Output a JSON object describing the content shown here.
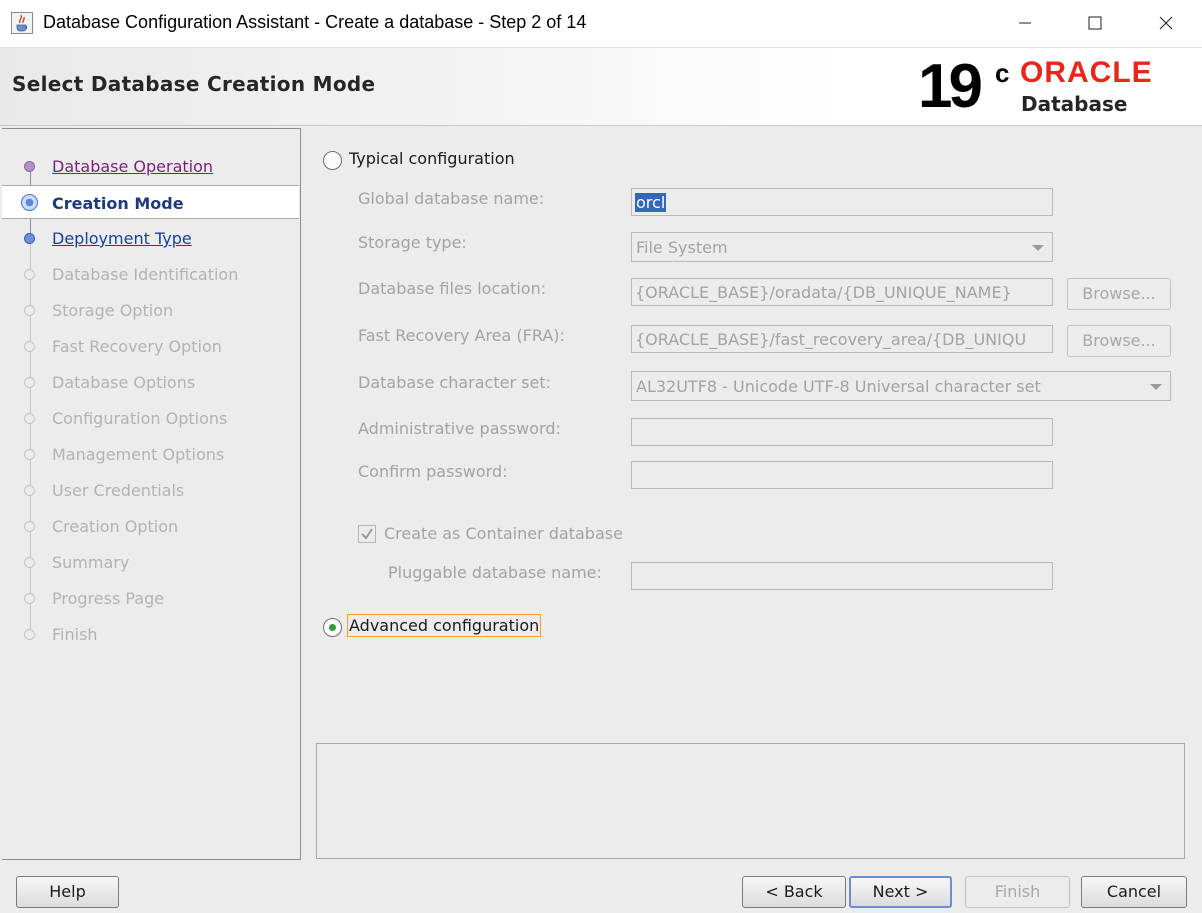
{
  "window": {
    "title": "Database Configuration Assistant - Create a database - Step 2 of 14",
    "icons": [
      "java-cup-icon",
      "minimize-icon",
      "maximize-icon",
      "close-icon"
    ]
  },
  "header": {
    "page_title": "Select Database Creation Mode",
    "logo_version": "19",
    "logo_version_sup": "c",
    "logo_brand": "ORACLE",
    "logo_product": "Database"
  },
  "steps": [
    {
      "label": "Database Operation",
      "state": "visited"
    },
    {
      "label": "Creation Mode",
      "state": "current"
    },
    {
      "label": "Deployment Type",
      "state": "link"
    },
    {
      "label": "Database Identification",
      "state": "disabled"
    },
    {
      "label": "Storage Option",
      "state": "disabled"
    },
    {
      "label": "Fast Recovery Option",
      "state": "disabled"
    },
    {
      "label": "Database Options",
      "state": "disabled"
    },
    {
      "label": "Configuration Options",
      "state": "disabled"
    },
    {
      "label": "Management Options",
      "state": "disabled"
    },
    {
      "label": "User Credentials",
      "state": "disabled"
    },
    {
      "label": "Creation Option",
      "state": "disabled"
    },
    {
      "label": "Summary",
      "state": "disabled"
    },
    {
      "label": "Progress Page",
      "state": "disabled"
    },
    {
      "label": "Finish",
      "state": "disabled"
    }
  ],
  "typical": {
    "radio_label": "Typical configuration",
    "selected": false,
    "global_db_name_label": "Global database name:",
    "global_db_name_value": "orcl",
    "storage_type_label": "Storage type:",
    "storage_type_value": "File System",
    "db_files_location_label": "Database files location:",
    "db_files_location_value": "{ORACLE_BASE}/oradata/{DB_UNIQUE_NAME}",
    "fra_label": "Fast Recovery Area (FRA):",
    "fra_value": "{ORACLE_BASE}/fast_recovery_area/{DB_UNIQU",
    "browse_label": "Browse...",
    "charset_label": "Database character set:",
    "charset_value": "AL32UTF8 - Unicode UTF-8 Universal character set",
    "admin_password_label": "Administrative password:",
    "admin_password_value": "",
    "confirm_password_label": "Confirm password:",
    "confirm_password_value": "",
    "container_checkbox_label": "Create as Container database",
    "container_checked": true,
    "pdb_name_label": "Pluggable database name:",
    "pdb_name_value": ""
  },
  "advanced": {
    "radio_label": "Advanced configuration",
    "selected": true
  },
  "buttons": {
    "help": "Help",
    "back": "< Back",
    "next": "Next >",
    "finish": "Finish",
    "cancel": "Cancel"
  },
  "colors": {
    "oracle_red": "#e8261c",
    "visited_step": "#7a1f7a",
    "link_step": "#1a3f9c",
    "selected_text_bg": "#3567b8",
    "radio_dot": "#2f9e37",
    "focus_border": "#f0a030"
  }
}
